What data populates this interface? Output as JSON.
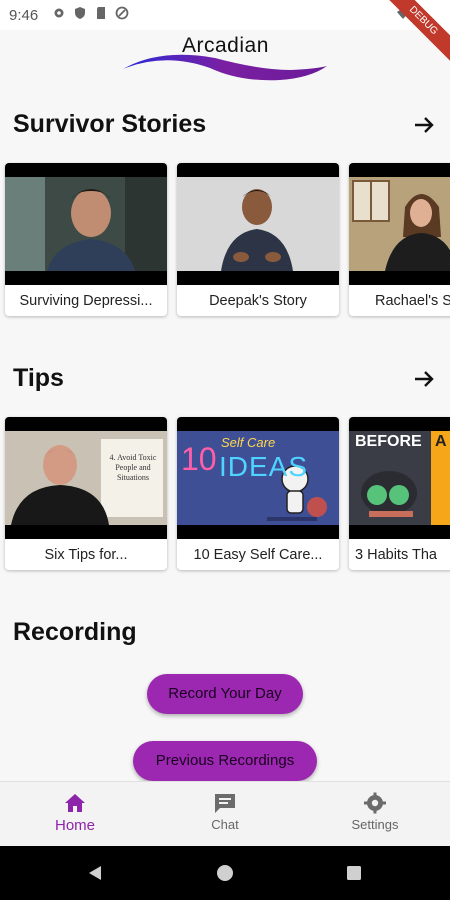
{
  "status_bar": {
    "time": "9:46"
  },
  "debug_banner": "DEBUG",
  "app": {
    "logo_text": "Arcadian"
  },
  "survivor_stories": {
    "title": "Survivor Stories",
    "cards": [
      {
        "label": "Surviving Depressi..."
      },
      {
        "label": "Deepak's Story"
      },
      {
        "label": "Rachael's S"
      }
    ]
  },
  "tips": {
    "title": "Tips",
    "cards": [
      {
        "label": "Six Tips for...",
        "thumb_text": "4. Avoid Toxic People and Situations"
      },
      {
        "label": "10 Easy Self Care...",
        "thumb_text_num": "10",
        "thumb_text_a": "Self Care",
        "thumb_text_b": "IDEAS"
      },
      {
        "label": "3 Habits Tha",
        "thumb_text": "BEFORE",
        "thumb_text_b": "A"
      }
    ]
  },
  "recording": {
    "title": "Recording",
    "record_label": "Record Your Day",
    "previous_label": "Previous Recordings"
  },
  "bottom_nav": [
    {
      "label": "Home",
      "active": true
    },
    {
      "label": "Chat",
      "active": false
    },
    {
      "label": "Settings",
      "active": false
    }
  ],
  "colors": {
    "accent": "#9c27b0",
    "nav_active": "#8e24aa"
  }
}
